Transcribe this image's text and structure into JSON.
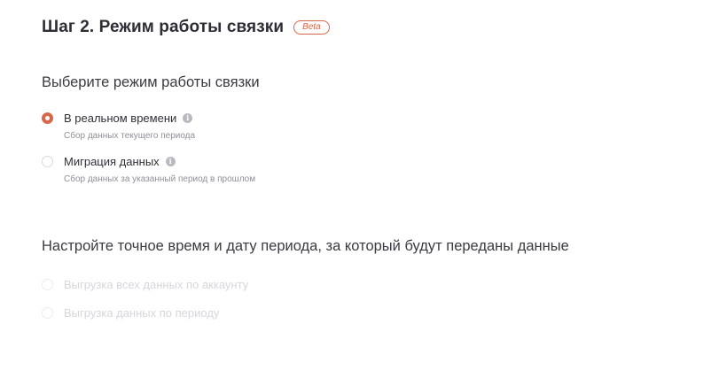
{
  "step": {
    "title": "Шаг 2. Режим работы связки",
    "badge": "Beta"
  },
  "mode_section": {
    "heading": "Выберите режим работы связки",
    "options": [
      {
        "label": "В реальном времени",
        "description": "Сбор данных текущего периода",
        "selected": true,
        "icon": "info-icon"
      },
      {
        "label": "Миграция данных",
        "description": "Сбор данных за указанный период в прошлом",
        "selected": false,
        "icon": "info-icon"
      }
    ]
  },
  "period_section": {
    "heading": "Настройте точное время и дату периода, за который будут переданы данные",
    "options": [
      {
        "label": "Выгрузка всех данных по аккаунту",
        "selected": false,
        "disabled": true
      },
      {
        "label": "Выгрузка данных по периоду",
        "selected": false,
        "disabled": true
      }
    ]
  },
  "colors": {
    "accent": "#d7684a",
    "disabled_text": "#d6d6dc"
  }
}
